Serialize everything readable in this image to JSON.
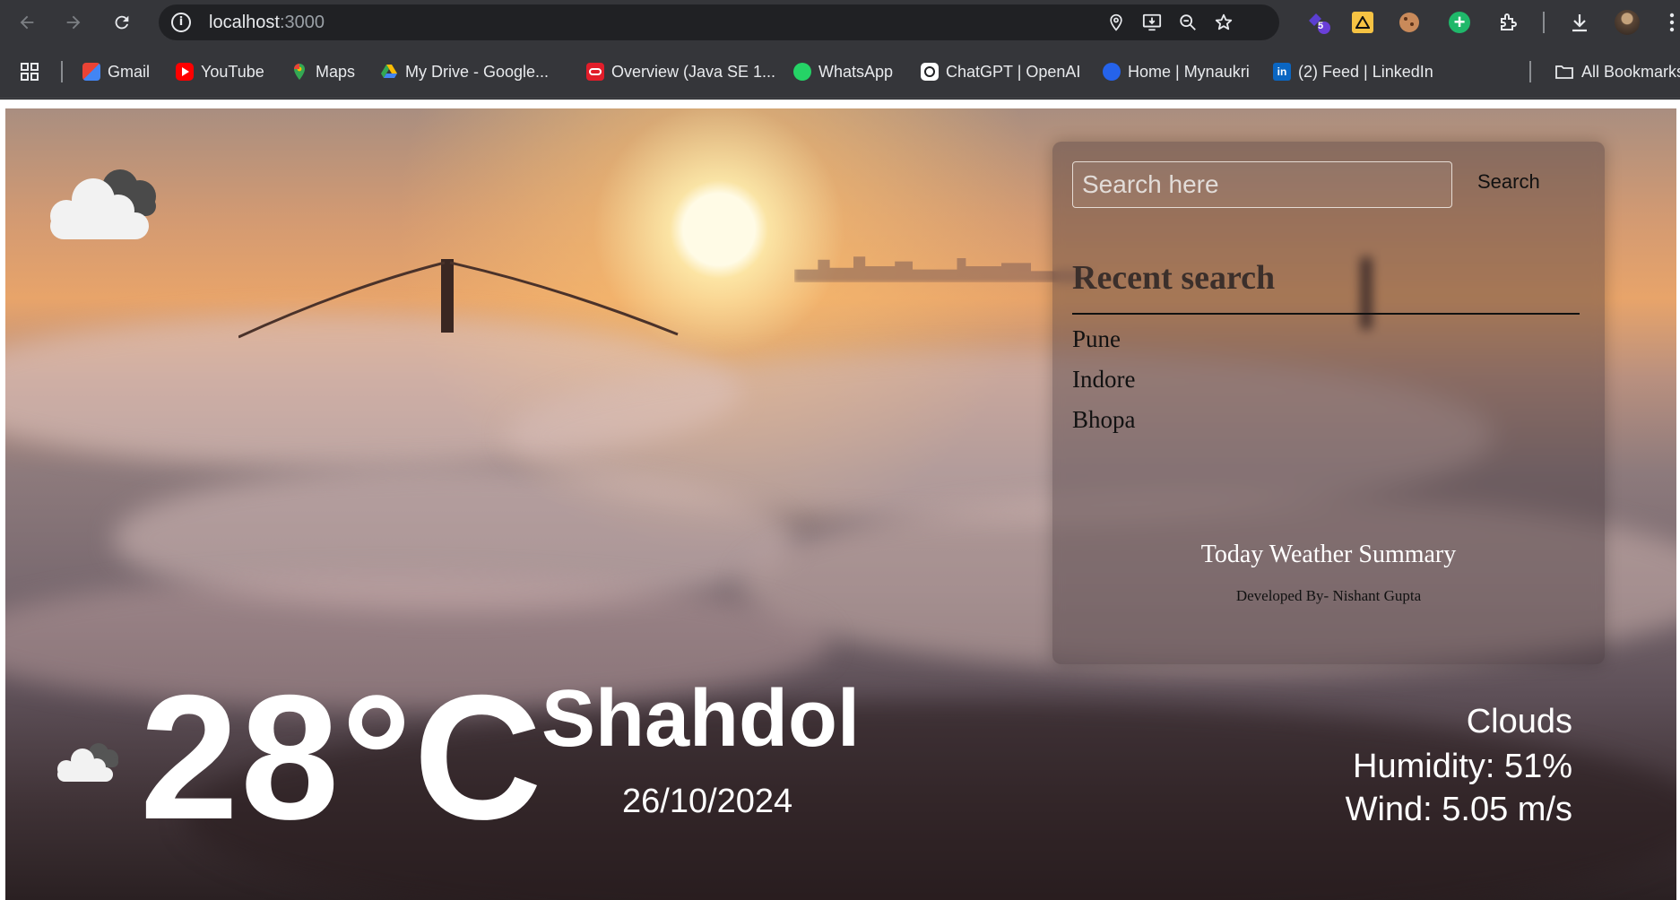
{
  "browser": {
    "url_host": "localhost",
    "url_port": ":3000",
    "extension_badge": "5",
    "bookmarks": [
      {
        "label": "Gmail",
        "color": "#ea4335"
      },
      {
        "label": "YouTube",
        "color": "#ff0000"
      },
      {
        "label": "Maps",
        "color": "#34a853"
      },
      {
        "label": "My Drive - Google...",
        "color": "#fbbc04"
      },
      {
        "label": "Overview (Java SE 1...",
        "color": "#e11d2a"
      },
      {
        "label": "WhatsApp",
        "color": "#25d366"
      },
      {
        "label": "ChatGPT | OpenAI",
        "color": "#ffffff"
      },
      {
        "label": "Home | Mynaukri",
        "color": "#2563eb"
      },
      {
        "label": "(2) Feed | LinkedIn",
        "color": "#0a66c2"
      }
    ],
    "all_bookmarks": "All Bookmarks"
  },
  "search": {
    "placeholder": "Search here",
    "button": "Search"
  },
  "recent": {
    "title": "Recent search",
    "items": [
      "Pune",
      "Indore",
      "Bhopa"
    ]
  },
  "summary": "Today Weather Summary",
  "developer": "Developed By- Nishant Gupta",
  "weather": {
    "temperature": "28°C",
    "city": "Shahdol",
    "date": "26/10/2024",
    "condition": "Clouds",
    "humidity": "Humidity: 51%",
    "wind": "Wind: 5.05 m/s",
    "icon": "cloud-icon"
  }
}
